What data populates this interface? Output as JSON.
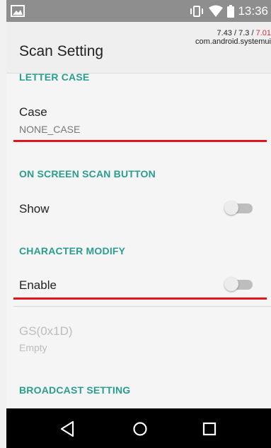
{
  "status_bar": {
    "time": "13:36",
    "icons": [
      "image-icon",
      "vibrate-icon",
      "wifi-icon",
      "battery-icon"
    ]
  },
  "overlay": {
    "line1_a": "7.43 / 7.3 / ",
    "line1_b": "7.01",
    "line2": "com.android.systemui"
  },
  "header": {
    "title": "Scan Setting"
  },
  "sections": {
    "letter_case": {
      "category": "LETTER CASE",
      "title": "Case",
      "summary": "NONE_CASE"
    },
    "scan_button": {
      "category": "ON SCREEN SCAN BUTTON",
      "title": "Show",
      "switch_on": false
    },
    "character_modify": {
      "category": "CHARACTER MODIFY",
      "title": "Enable",
      "switch_on": false,
      "gs_title": "GS(0x1D)",
      "gs_summary": "Empty"
    },
    "broadcast": {
      "category": "BROADCAST SETTING"
    }
  },
  "nav_bar": {
    "icons": [
      "back-icon",
      "home-icon",
      "recents-icon"
    ]
  },
  "colors": {
    "accent": "#2a9d8f",
    "highlight_red": "#e0161c"
  }
}
